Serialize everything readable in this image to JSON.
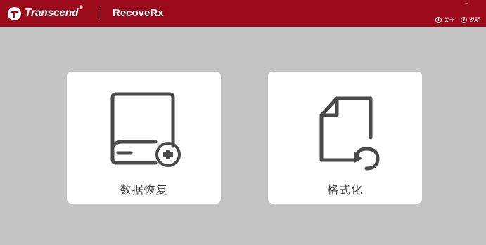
{
  "header": {
    "brand": "Transcend",
    "app_title": "RecoveRx",
    "minimize": "–",
    "links": [
      {
        "label": "关于",
        "icon": "info-icon"
      },
      {
        "label": "说明",
        "icon": "help-icon"
      }
    ]
  },
  "cards": [
    {
      "label": "数据恢复",
      "icon": "drive-add-icon"
    },
    {
      "label": "格式化",
      "icon": "file-format-icon"
    }
  ],
  "colors": {
    "header": "#9b0a1a",
    "background": "#c4c4c4",
    "card": "#ffffff",
    "icon": "#4a4a4a"
  }
}
